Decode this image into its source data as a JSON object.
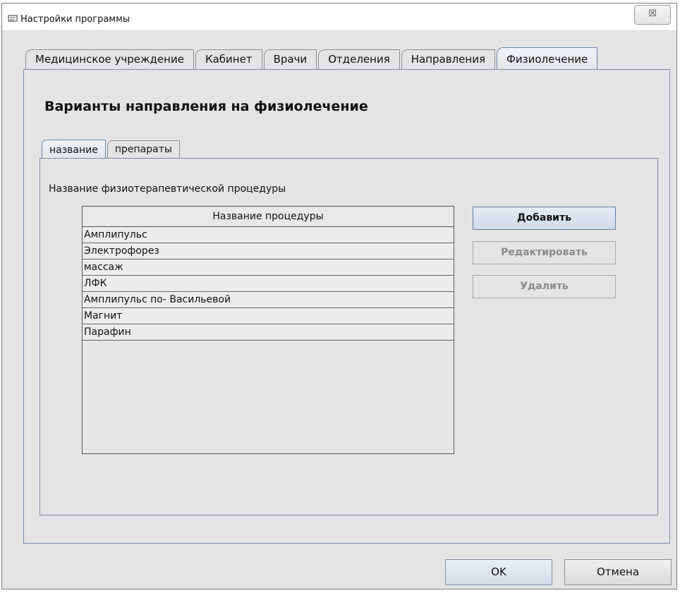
{
  "window": {
    "title": "Настройки программы",
    "close_label": "☒",
    "app_icon": "settings-icon"
  },
  "outer_tabs": [
    {
      "label": "Медицинское учреждение",
      "active": false
    },
    {
      "label": "Кабинет",
      "active": false
    },
    {
      "label": "Врачи",
      "active": false
    },
    {
      "label": "Отделения",
      "active": false
    },
    {
      "label": "Направления",
      "active": false
    },
    {
      "label": "Физиолечение",
      "active": true
    }
  ],
  "section": {
    "title": "Варианты направления на физиолечение"
  },
  "inner_tabs": [
    {
      "label": "название",
      "active": true
    },
    {
      "label": "препараты",
      "active": false
    }
  ],
  "procedures": {
    "field_label": "Название физиотерапевтической процедуры",
    "column_header": "Название процедуры",
    "rows": [
      "Амплипульс",
      "Электрофорез",
      "массаж",
      "ЛФК",
      "Амплипульс по- Васильевой",
      "Магнит",
      "Парафин"
    ]
  },
  "actions": {
    "add": "Добавить",
    "edit": "Редактировать",
    "delete": "Удалить"
  },
  "footer": {
    "ok": "OK",
    "cancel": "Отмена"
  },
  "colors": {
    "accent": "#5f7e9f",
    "window_bg": "#e4e4e4"
  }
}
